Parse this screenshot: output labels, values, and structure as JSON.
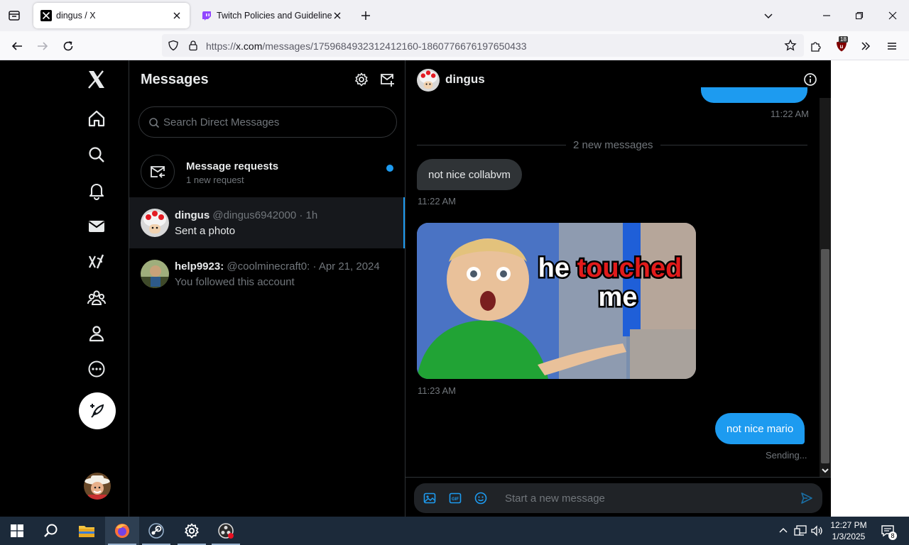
{
  "browser": {
    "tabs": [
      {
        "title": "dingus / X",
        "active": true
      },
      {
        "title": "Twitch Policies and Guidelines",
        "active": false
      }
    ],
    "url": {
      "scheme": "https://",
      "host": "x.com",
      "path": "/messages/1759684932312412160-1860776676197650433"
    },
    "extension_badge": "18"
  },
  "sidebar_nav": [
    "x-logo",
    "home",
    "explore",
    "notifications",
    "messages",
    "grok",
    "communities",
    "profile",
    "more",
    "post"
  ],
  "messages_panel": {
    "title": "Messages",
    "search_placeholder": "Search Direct Messages",
    "request": {
      "title": "Message requests",
      "subtitle": "1 new request"
    },
    "conversations": [
      {
        "name": "dingus",
        "handle": "@dingus6942000",
        "time": "· 1h",
        "preview": "Sent a photo",
        "selected": true
      },
      {
        "name": "help9923:",
        "handle": "@coolminecraft0:",
        "time": "· Apr 21, 2024",
        "preview": "You followed this account",
        "selected": false
      }
    ]
  },
  "chat": {
    "name": "dingus",
    "top_time": "11:22 AM",
    "divider": "2 new messages",
    "incoming_text": "not nice collabvm",
    "incoming_time": "11:22 AM",
    "photo_caption": {
      "word1": "he",
      "word2": "touched",
      "word3": "me"
    },
    "photo_time": "11:23 AM",
    "outgoing_text": "not nice mario",
    "outgoing_status": "Sending...",
    "composer_placeholder": "Start a new message"
  },
  "taskbar": {
    "time": "12:27 PM",
    "date": "1/3/2025",
    "notifications": "8"
  },
  "colors": {
    "accent": "#1d9bf0",
    "background": "#000000",
    "bubble_in": "#2f3336"
  }
}
